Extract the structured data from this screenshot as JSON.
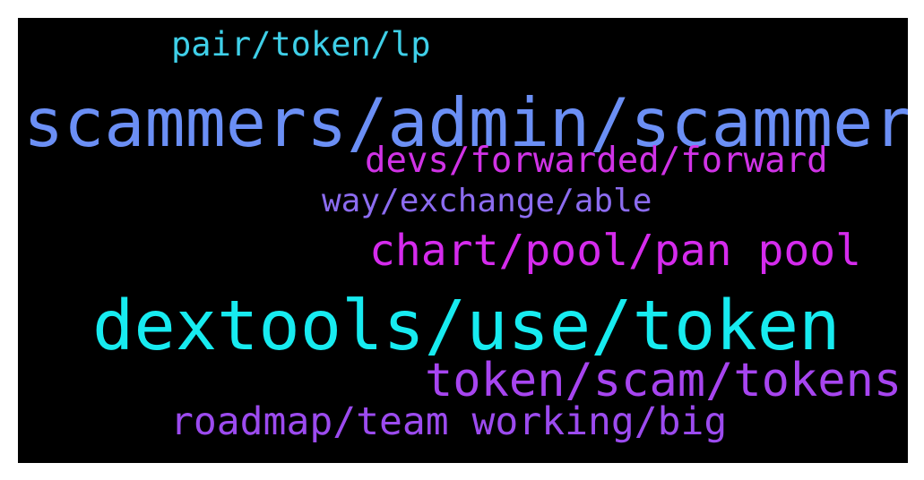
{
  "background": "#000000",
  "words": [
    {
      "text": "pair/token/lp",
      "color": "#3fcfe8"
    },
    {
      "text": "scammers/admin/scammer",
      "color": "#6b8ff5"
    },
    {
      "text": "devs/forwarded/forward",
      "color": "#d033e6"
    },
    {
      "text": "way/exchange/able",
      "color": "#8c6cf0"
    },
    {
      "text": "chart/pool/pan pool",
      "color": "#d52bed"
    },
    {
      "text": "dextools/use/token",
      "color": "#17ebf0"
    },
    {
      "text": "token/scam/tokens",
      "color": "#a745f0"
    },
    {
      "text": "roadmap/team working/big",
      "color": "#9c4bef"
    }
  ]
}
